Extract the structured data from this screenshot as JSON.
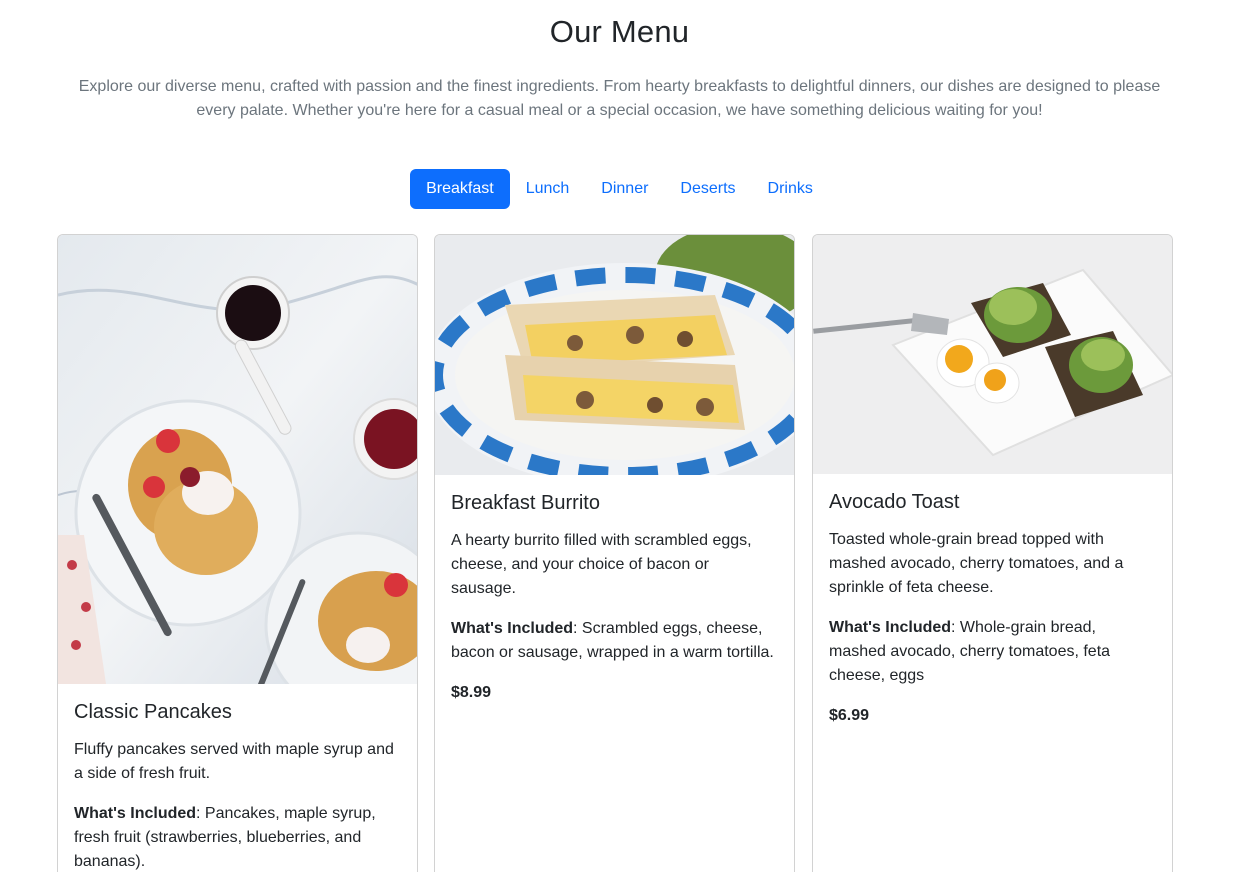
{
  "page": {
    "title": "Our Menu",
    "intro": "Explore our diverse menu, crafted with passion and the finest ingredients. From hearty breakfasts to delightful dinners, our dishes are designed to please every palate. Whether you're here for a casual meal or a special occasion, we have something delicious waiting for you!"
  },
  "tabs": [
    {
      "label": "Breakfast",
      "active": true
    },
    {
      "label": "Lunch",
      "active": false
    },
    {
      "label": "Dinner",
      "active": false
    },
    {
      "label": "Deserts",
      "active": false
    },
    {
      "label": "Drinks",
      "active": false
    }
  ],
  "colors": {
    "accent": "#0d6efd",
    "muted_text": "#6c757d",
    "text": "#212529"
  },
  "menu_items": [
    {
      "name": "Classic Pancakes",
      "description": "Fluffy pancakes served with maple syrup and a side of fresh fruit.",
      "included_label": "What's Included",
      "included": ": Pancakes, maple syrup, fresh fruit (strawberries, blueberries, and bananas).",
      "price": "",
      "image": "pancakes-photo"
    },
    {
      "name": "Breakfast Burrito",
      "description": "A hearty burrito filled with scrambled eggs, cheese, and your choice of bacon or sausage.",
      "included_label": "What's Included",
      "included": ": Scrambled eggs, cheese, bacon or sausage, wrapped in a warm tortilla.",
      "price": "$8.99",
      "image": "burrito-photo"
    },
    {
      "name": "Avocado Toast",
      "description": "Toasted whole-grain bread topped with mashed avocado, cherry tomatoes, and a sprinkle of feta cheese.",
      "included_label": "What's Included",
      "included": ": Whole-grain bread, mashed avocado, cherry tomatoes, feta cheese, eggs",
      "price": "$6.99",
      "image": "avocado-toast-photo"
    }
  ]
}
